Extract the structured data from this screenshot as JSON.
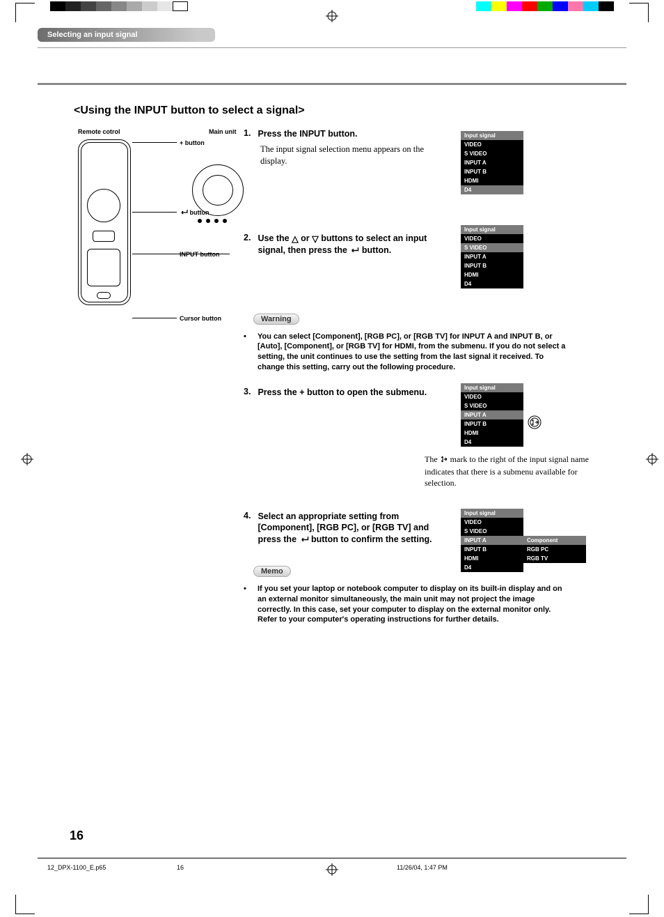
{
  "section_tab": "Selecting an input signal",
  "title": "<Using the INPUT button to select a signal>",
  "labels": {
    "remote": "Remote cotrol",
    "main_unit": "Main unit",
    "plus_button": "+ button",
    "enter_button": "button",
    "input_button": "INPUT button",
    "cursor_button": "Cursor button"
  },
  "steps": [
    {
      "num": "1.",
      "title": "Press the INPUT button.",
      "body": "The input signal selection menu appears on the display."
    },
    {
      "num": "2.",
      "title": "Use the △ or ▽ buttons to select an input signal, then press the       button.",
      "body": ""
    },
    {
      "num": "3.",
      "title": "Press the + button to open the submenu.",
      "body": ""
    },
    {
      "num": "4.",
      "title": "Select an appropriate setting from  [Component], [RGB PC], or [RGB TV] and press the       button to confirm the setting.",
      "body": ""
    }
  ],
  "warning_label": "Warning",
  "warning_text": "You can select [Component], [RGB PC], or [RGB TV] for INPUT A and INPUT B, or [Auto], [Component], or [RGB TV] for HDMI, from the submenu. If you do not select a setting, the unit continues to use the setting from the last signal it received. To change this setting, carry out the following procedure.",
  "memo_label": "Memo",
  "memo_text": "If you set your laptop or notebook computer to display on its built-in display and on an external monitor simultaneously, the main unit may not project the image correctly. In this case, set your computer to display on the external monitor only. Refer to your computer's operating instructions for further details.",
  "submenu_note_a": "The ",
  "submenu_note_b": " mark to the right of the input signal name indicates that there is a submenu available for selection.",
  "input_header": "Input signal",
  "inputs": [
    "VIDEO",
    "S VIDEO",
    "INPUT A",
    "INPUT B",
    "HDMI",
    "D4"
  ],
  "submenu_opts": [
    "Component",
    "RGB PC",
    "RGB TV"
  ],
  "page_number": "16",
  "footer_file": "12_DPX-1100_E.p65",
  "footer_page": "16",
  "footer_date": "11/26/04, 1:47 PM"
}
